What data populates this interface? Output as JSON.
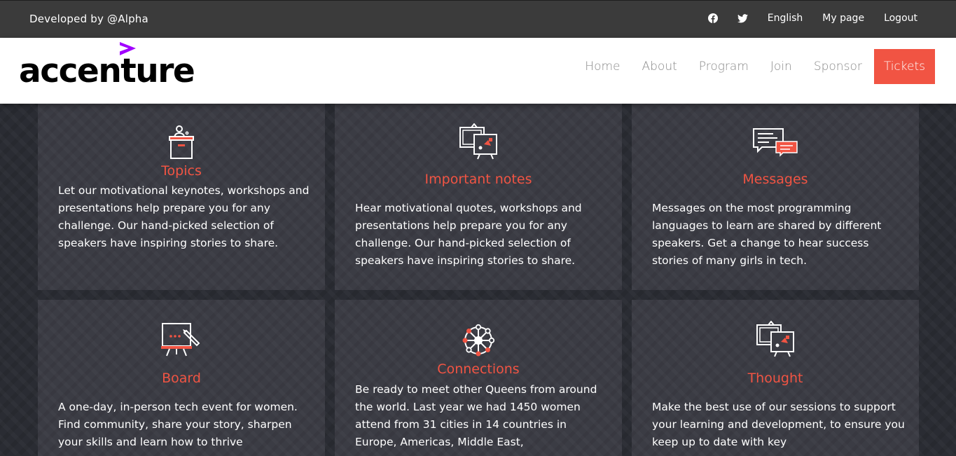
{
  "topbar": {
    "developer": "Developed by @Alpha",
    "facebook_icon": "facebook-icon",
    "twitter_icon": "twitter-icon",
    "language": "English",
    "my_page": "My page",
    "logout": "Logout"
  },
  "brand": {
    "name": "accenture",
    "accent_color": "#a100ff"
  },
  "nav": {
    "home": "Home",
    "about": "About",
    "program": "Program",
    "join": "Join",
    "sponsor": "Sponsor",
    "tickets": "Tickets",
    "tickets_color": "#f15443"
  },
  "cards": [
    {
      "icon": "podium-icon",
      "title": "Topics",
      "text": "Let our motivational keynotes, workshops and presentations help prepare you for any challenge. Our hand-picked selection of speakers have inspiring stories to share."
    },
    {
      "icon": "presentation-screens-icon",
      "title": "Important notes",
      "text": "Hear motivational quotes, workshops and presentations help prepare you for any challenge. Our hand-picked selection of speakers have inspiring stories to share."
    },
    {
      "icon": "chat-bubbles-icon",
      "title": "Messages",
      "text": "Messages on the most programming languages to learn are shared by different speakers. Get a change to hear success stories of many girls in tech."
    },
    {
      "icon": "whiteboard-icon",
      "title": "Board",
      "text": "A one-day, in-person tech event for women. Find community, share your story, sharpen your skills and learn how to thrive"
    },
    {
      "icon": "network-icon",
      "title": "Connections",
      "text": "Be ready to meet other Queens from around the world. Last year we had 1450 women attend from 31 cities in 14 countries in Europe, Americas, Middle East,"
    },
    {
      "icon": "presentation-screens-icon",
      "title": "Thought",
      "text": "Make the best use of our sessions to support your learning and development, to ensure you keep up to date with key"
    }
  ]
}
